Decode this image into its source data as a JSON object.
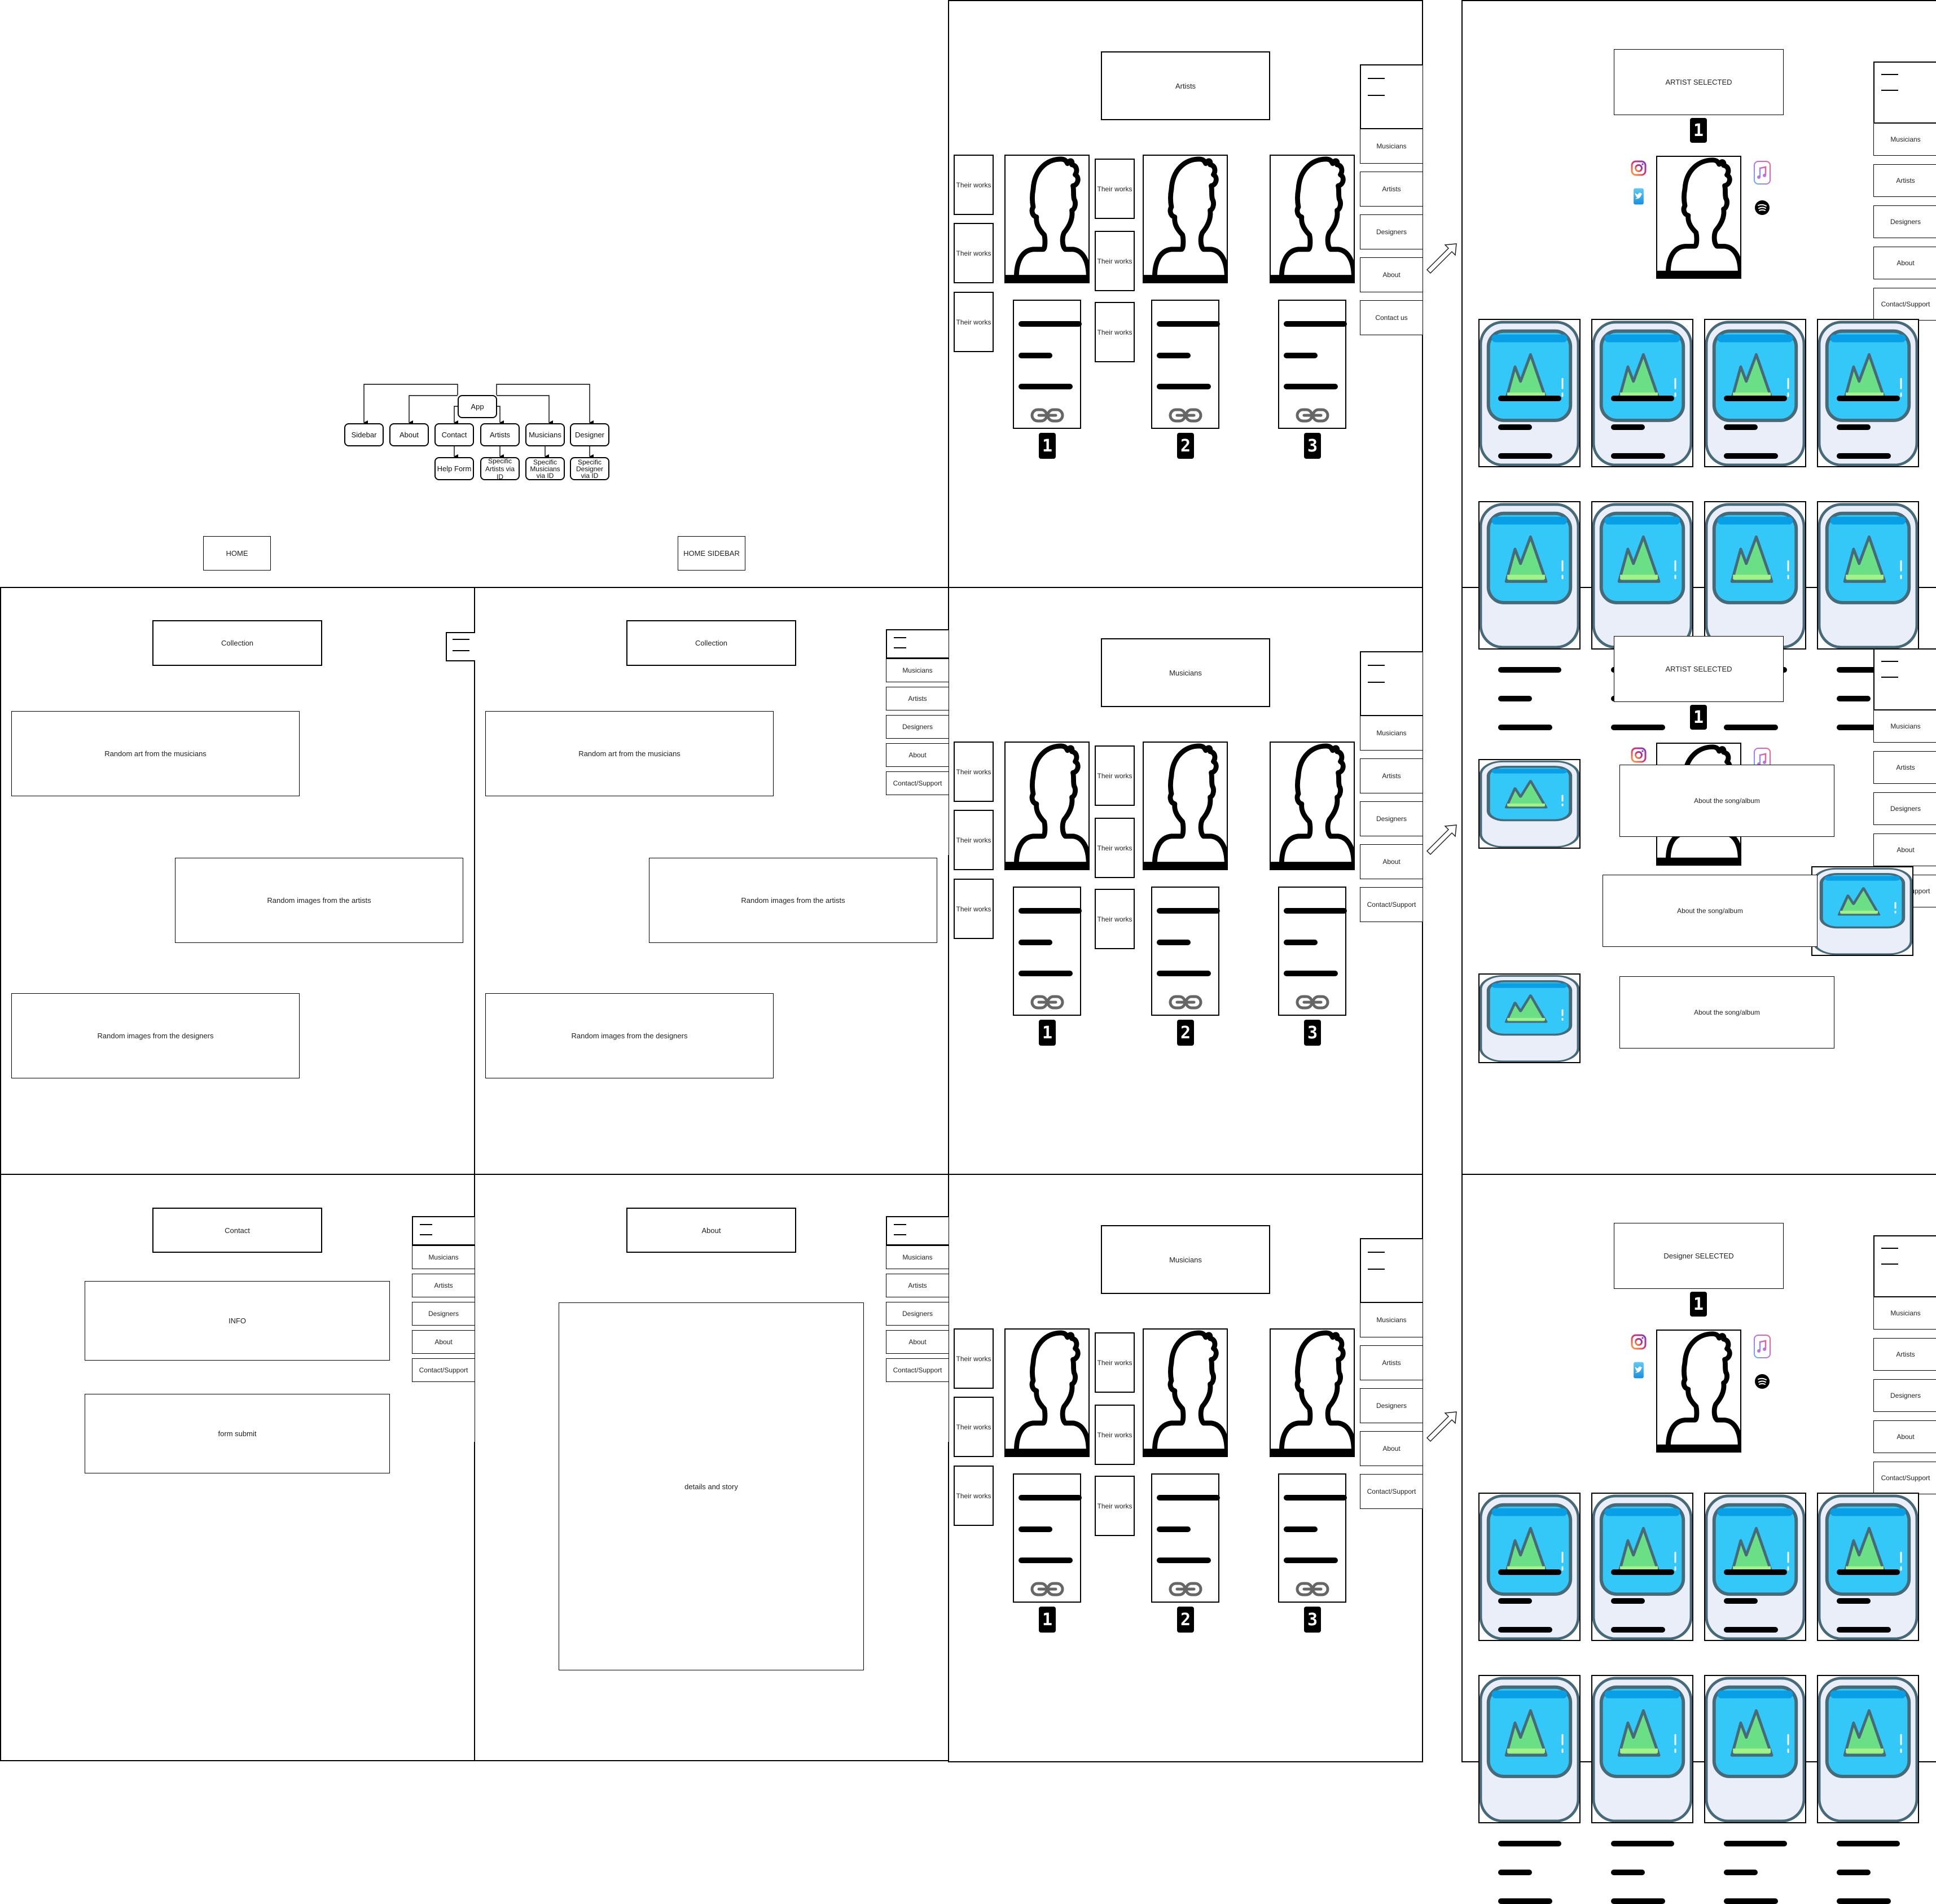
{
  "sitemap": {
    "root": "App",
    "children": [
      "Sidebar",
      "About",
      "Contact",
      "Artists",
      "Musicians",
      "Designer"
    ],
    "grandchildren": [
      "Help Form",
      "Specific Artists via ID",
      "Specific Musicians via ID",
      "Specific Designer via ID"
    ],
    "labels": {
      "home": "HOME",
      "home_sidebar": "HOME SIDEBAR"
    }
  },
  "sidebar_nav": {
    "items": [
      "Musicians",
      "Artists",
      "Designers",
      "About",
      "Contact/Support"
    ],
    "items_artists_page": [
      "Musicians",
      "Artists",
      "Designers",
      "About",
      "Contact us"
    ]
  },
  "collection": {
    "title": "Collection",
    "blocks": [
      "Random art from the musicians",
      "Random images from the artists",
      "Random images from the designers"
    ]
  },
  "contact": {
    "title": "Contact",
    "info": "INFO",
    "form": "form submit"
  },
  "about": {
    "title": "About",
    "body": "details and story"
  },
  "listing_pages": [
    {
      "title": "Artists"
    },
    {
      "title": "Musicians"
    },
    {
      "title": "Musicians"
    }
  ],
  "listing": {
    "works_label": "Their works",
    "badges": [
      "1",
      "2",
      "3"
    ]
  },
  "detail_pages": [
    {
      "title": "ARTIST SELECTED",
      "badge": "1"
    },
    {
      "title": "ARTIST SELECTED",
      "badge": "1",
      "about_label": "About the song/album"
    },
    {
      "title": "Designer SELECTED",
      "badge": "1"
    }
  ],
  "social_icons": [
    "instagram-icon",
    "twitter-icon",
    "apple-music-icon",
    "spotify-icon"
  ],
  "colors": {
    "image_blue": "#33c8f7",
    "image_frame": "#466a78",
    "image_bg": "#e9eef8",
    "mountain_green": "#6adf86",
    "link_gray": "#666666"
  }
}
